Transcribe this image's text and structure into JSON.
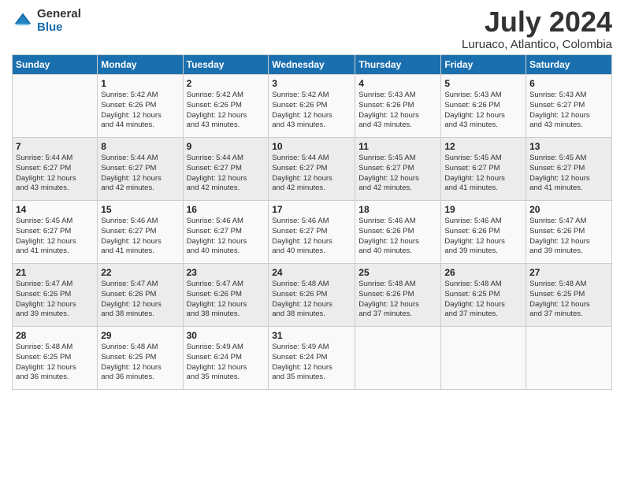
{
  "header": {
    "logo_general": "General",
    "logo_blue": "Blue",
    "month_year": "July 2024",
    "location": "Luruaco, Atlantico, Colombia"
  },
  "columns": [
    "Sunday",
    "Monday",
    "Tuesday",
    "Wednesday",
    "Thursday",
    "Friday",
    "Saturday"
  ],
  "weeks": [
    [
      {
        "day": "",
        "info": ""
      },
      {
        "day": "1",
        "info": "Sunrise: 5:42 AM\nSunset: 6:26 PM\nDaylight: 12 hours\nand 44 minutes."
      },
      {
        "day": "2",
        "info": "Sunrise: 5:42 AM\nSunset: 6:26 PM\nDaylight: 12 hours\nand 43 minutes."
      },
      {
        "day": "3",
        "info": "Sunrise: 5:42 AM\nSunset: 6:26 PM\nDaylight: 12 hours\nand 43 minutes."
      },
      {
        "day": "4",
        "info": "Sunrise: 5:43 AM\nSunset: 6:26 PM\nDaylight: 12 hours\nand 43 minutes."
      },
      {
        "day": "5",
        "info": "Sunrise: 5:43 AM\nSunset: 6:26 PM\nDaylight: 12 hours\nand 43 minutes."
      },
      {
        "day": "6",
        "info": "Sunrise: 5:43 AM\nSunset: 6:27 PM\nDaylight: 12 hours\nand 43 minutes."
      }
    ],
    [
      {
        "day": "7",
        "info": "Sunrise: 5:44 AM\nSunset: 6:27 PM\nDaylight: 12 hours\nand 43 minutes."
      },
      {
        "day": "8",
        "info": "Sunrise: 5:44 AM\nSunset: 6:27 PM\nDaylight: 12 hours\nand 42 minutes."
      },
      {
        "day": "9",
        "info": "Sunrise: 5:44 AM\nSunset: 6:27 PM\nDaylight: 12 hours\nand 42 minutes."
      },
      {
        "day": "10",
        "info": "Sunrise: 5:44 AM\nSunset: 6:27 PM\nDaylight: 12 hours\nand 42 minutes."
      },
      {
        "day": "11",
        "info": "Sunrise: 5:45 AM\nSunset: 6:27 PM\nDaylight: 12 hours\nand 42 minutes."
      },
      {
        "day": "12",
        "info": "Sunrise: 5:45 AM\nSunset: 6:27 PM\nDaylight: 12 hours\nand 41 minutes."
      },
      {
        "day": "13",
        "info": "Sunrise: 5:45 AM\nSunset: 6:27 PM\nDaylight: 12 hours\nand 41 minutes."
      }
    ],
    [
      {
        "day": "14",
        "info": "Sunrise: 5:45 AM\nSunset: 6:27 PM\nDaylight: 12 hours\nand 41 minutes."
      },
      {
        "day": "15",
        "info": "Sunrise: 5:46 AM\nSunset: 6:27 PM\nDaylight: 12 hours\nand 41 minutes."
      },
      {
        "day": "16",
        "info": "Sunrise: 5:46 AM\nSunset: 6:27 PM\nDaylight: 12 hours\nand 40 minutes."
      },
      {
        "day": "17",
        "info": "Sunrise: 5:46 AM\nSunset: 6:27 PM\nDaylight: 12 hours\nand 40 minutes."
      },
      {
        "day": "18",
        "info": "Sunrise: 5:46 AM\nSunset: 6:26 PM\nDaylight: 12 hours\nand 40 minutes."
      },
      {
        "day": "19",
        "info": "Sunrise: 5:46 AM\nSunset: 6:26 PM\nDaylight: 12 hours\nand 39 minutes."
      },
      {
        "day": "20",
        "info": "Sunrise: 5:47 AM\nSunset: 6:26 PM\nDaylight: 12 hours\nand 39 minutes."
      }
    ],
    [
      {
        "day": "21",
        "info": "Sunrise: 5:47 AM\nSunset: 6:26 PM\nDaylight: 12 hours\nand 39 minutes."
      },
      {
        "day": "22",
        "info": "Sunrise: 5:47 AM\nSunset: 6:26 PM\nDaylight: 12 hours\nand 38 minutes."
      },
      {
        "day": "23",
        "info": "Sunrise: 5:47 AM\nSunset: 6:26 PM\nDaylight: 12 hours\nand 38 minutes."
      },
      {
        "day": "24",
        "info": "Sunrise: 5:48 AM\nSunset: 6:26 PM\nDaylight: 12 hours\nand 38 minutes."
      },
      {
        "day": "25",
        "info": "Sunrise: 5:48 AM\nSunset: 6:26 PM\nDaylight: 12 hours\nand 37 minutes."
      },
      {
        "day": "26",
        "info": "Sunrise: 5:48 AM\nSunset: 6:25 PM\nDaylight: 12 hours\nand 37 minutes."
      },
      {
        "day": "27",
        "info": "Sunrise: 5:48 AM\nSunset: 6:25 PM\nDaylight: 12 hours\nand 37 minutes."
      }
    ],
    [
      {
        "day": "28",
        "info": "Sunrise: 5:48 AM\nSunset: 6:25 PM\nDaylight: 12 hours\nand 36 minutes."
      },
      {
        "day": "29",
        "info": "Sunrise: 5:48 AM\nSunset: 6:25 PM\nDaylight: 12 hours\nand 36 minutes."
      },
      {
        "day": "30",
        "info": "Sunrise: 5:49 AM\nSunset: 6:24 PM\nDaylight: 12 hours\nand 35 minutes."
      },
      {
        "day": "31",
        "info": "Sunrise: 5:49 AM\nSunset: 6:24 PM\nDaylight: 12 hours\nand 35 minutes."
      },
      {
        "day": "",
        "info": ""
      },
      {
        "day": "",
        "info": ""
      },
      {
        "day": "",
        "info": ""
      }
    ]
  ]
}
